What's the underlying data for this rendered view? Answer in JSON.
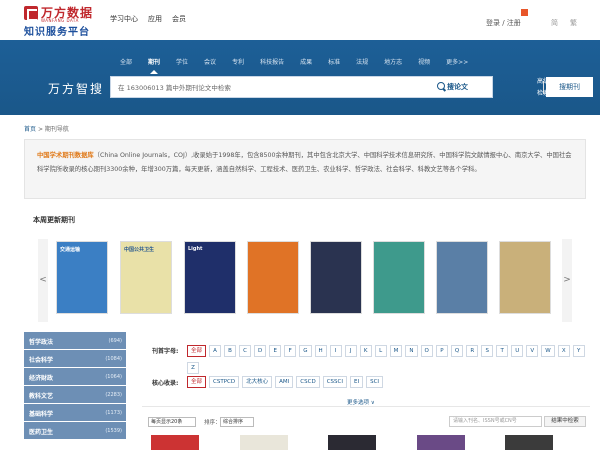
{
  "brand": {
    "name_cn": "万方数据",
    "name_en": "WANFANG DATA",
    "subtitle": "知识服务平台"
  },
  "top_nav": [
    "学习中心",
    "应用",
    "会员"
  ],
  "user": {
    "login": "登录 / 注册"
  },
  "lang": [
    "简",
    "繁"
  ],
  "search_band": {
    "title": "万方智搜",
    "tabs": [
      "全部",
      "期刊",
      "学位",
      "会议",
      "专利",
      "科技报告",
      "成果",
      "标准",
      "法规",
      "地方志",
      "视频",
      "更多>>"
    ],
    "active_tab": "期刊",
    "placeholder": "在 163006013 篇中外期刊论文中检索",
    "smart_search": "搜论文",
    "search_button": "搜期刊",
    "advanced": "高级检索",
    "history": "检索历史"
  },
  "breadcrumb": {
    "home": "首页",
    "sep": ">",
    "current": "期刊导航"
  },
  "intro": {
    "highlight": "中国学术期刊数据库",
    "text": "（China Online Journals，COJ）,收录始于1998年，包含8500余种期刊，其中包含北京大学、中国科学技术信息研究所、中国科学院文献情报中心、南京大学、中国社会科学院所收录的核心期刊3300余种，年增300万篇，每天更新，涵盖自然科学、工程技术、医药卫生、农业科学、哲学政法、社会科学、科教文艺等各个学科。"
  },
  "weekly": {
    "title": "本周更新期刊",
    "prev": "<",
    "next": ">",
    "covers": [
      {
        "title": "交通运输",
        "color": "#3b7fc4"
      },
      {
        "title": "中国公共卫生",
        "color": "#e9e1a8"
      },
      {
        "title": "Light",
        "color": "#1f2f6a"
      },
      {
        "title": "",
        "color": "#e07326"
      },
      {
        "title": "",
        "color": "#2a3350"
      },
      {
        "title": "",
        "color": "#3e9a8c"
      },
      {
        "title": "",
        "color": "#5a7fa6"
      },
      {
        "title": "",
        "color": "#c9b07a"
      }
    ]
  },
  "sidebar": [
    {
      "name": "哲学政法",
      "count": "(694)"
    },
    {
      "name": "社会科学",
      "count": "(1084)"
    },
    {
      "name": "经济财政",
      "count": "(1064)"
    },
    {
      "name": "教科文艺",
      "count": "(2283)"
    },
    {
      "name": "基础科学",
      "count": "(1173)"
    },
    {
      "name": "医药卫生",
      "count": "(1539)"
    }
  ],
  "filters": {
    "initial_label": "刊首字母:",
    "letters": [
      "全部",
      "A",
      "B",
      "C",
      "D",
      "E",
      "F",
      "G",
      "H",
      "I",
      "J",
      "K",
      "L",
      "M",
      "N",
      "O",
      "P",
      "Q",
      "R",
      "S",
      "T",
      "U",
      "V",
      "W",
      "X",
      "Y",
      "Z"
    ],
    "core_label": "核心收录:",
    "core": [
      "全部",
      "CSTPCD",
      "北大核心",
      "AMI",
      "CSCD",
      "CSSCI",
      "EI",
      "SCI"
    ],
    "more": "更多选项 ∨"
  },
  "toolbar": {
    "per_page": "每页显示20条",
    "sort_label": "排序：",
    "sort_value": "综合排序",
    "search_placeholder": "请输入刊名、ISSN号或CN号",
    "search_button": "结果中检索"
  },
  "colors": {
    "brand_red": "#c0282d",
    "band_blue": "#1a5789",
    "sidebar_blue": "#6d8fb5",
    "highlight_orange": "#e07a1a"
  }
}
